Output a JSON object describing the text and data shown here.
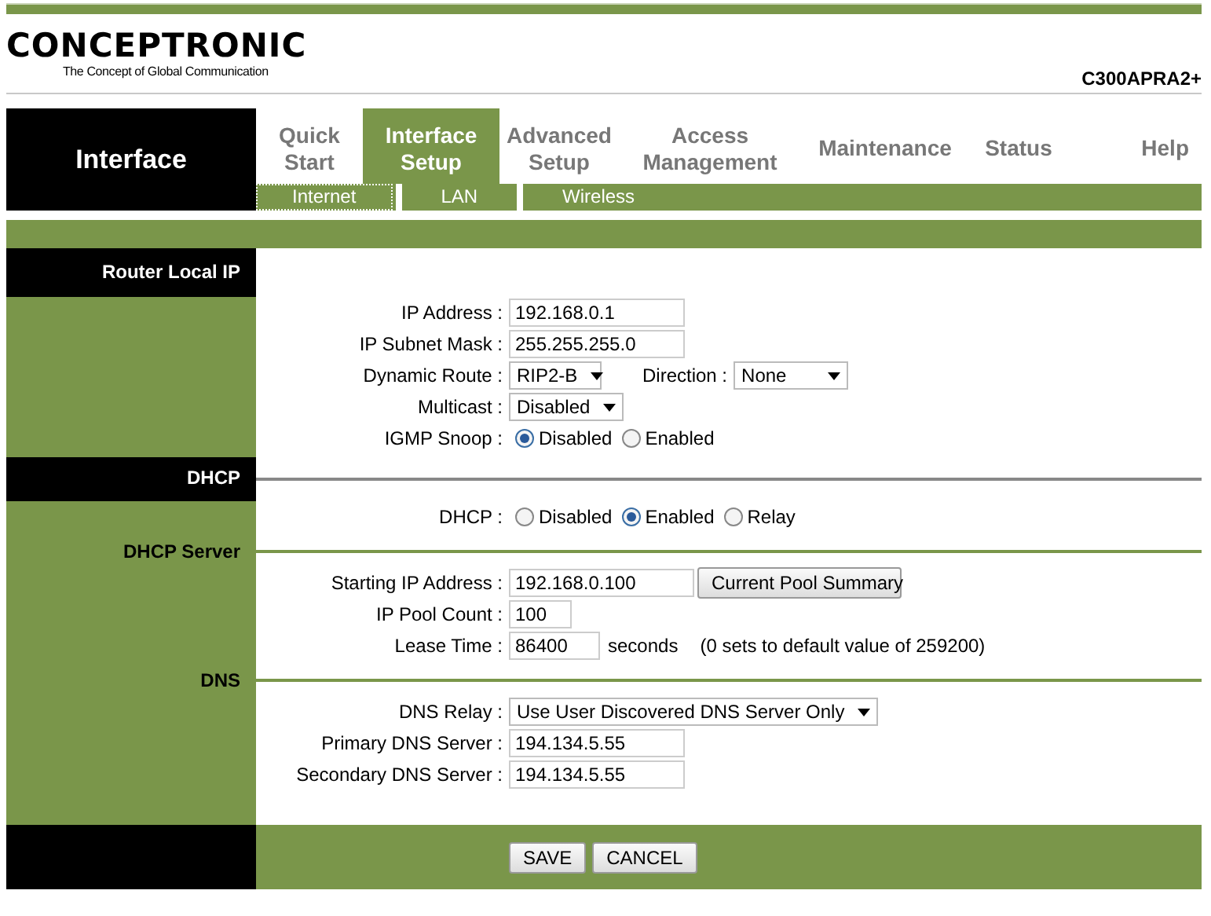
{
  "logo": {
    "brand": "CONCEPTRONIC",
    "tagline": "The Concept of Global Communication"
  },
  "model": "C300APRA2+",
  "section_title": "Interface",
  "tabs": [
    {
      "label": "Quick Start",
      "selected": false
    },
    {
      "label": "Interface Setup",
      "selected": true
    },
    {
      "label": "Advanced Setup",
      "selected": false
    },
    {
      "label": "Access Management",
      "selected": false
    },
    {
      "label": "Maintenance",
      "selected": false
    },
    {
      "label": "Status",
      "selected": false
    },
    {
      "label": "Help",
      "selected": false
    }
  ],
  "subtabs": [
    {
      "label": "Internet",
      "selected": true
    },
    {
      "label": "LAN",
      "selected": false
    },
    {
      "label": "Wireless",
      "selected": false
    }
  ],
  "sections": [
    {
      "title": "Router Local IP",
      "kind": "header",
      "rows": [
        {
          "kind": "input",
          "label": "IP Address :",
          "value": "192.168.0.1"
        },
        {
          "kind": "input",
          "label": "IP Subnet Mask :",
          "value": "255.255.255.0"
        },
        {
          "kind": "select_pair",
          "label": "Dynamic Route :",
          "value": "RIP2-B",
          "extra_label": "Direction :",
          "extra_value": "None"
        },
        {
          "kind": "select",
          "label": "Multicast :",
          "value": "Disabled"
        },
        {
          "kind": "radio",
          "label": "IGMP Snoop :",
          "options": [
            {
              "label": "Disabled",
              "selected": true
            },
            {
              "label": "Enabled",
              "selected": false
            }
          ]
        }
      ]
    },
    {
      "title": "DHCP",
      "kind": "header",
      "rows": [
        {
          "kind": "radio",
          "label": "DHCP :",
          "options": [
            {
              "label": "Disabled",
              "selected": false
            },
            {
              "label": "Enabled",
              "selected": true
            },
            {
              "label": "Relay",
              "selected": false
            }
          ]
        }
      ]
    },
    {
      "title": "DHCP Server",
      "kind": "sub",
      "rows": [
        {
          "kind": "input_button",
          "label": "Starting IP Address :",
          "value": "192.168.0.100",
          "button": "Current Pool Summary"
        },
        {
          "kind": "input_short",
          "label": "IP Pool Count :",
          "value": "100"
        },
        {
          "kind": "input_unit",
          "label": "Lease Time :",
          "value": "86400",
          "unit": "seconds",
          "note": "(0 sets to default value of 259200)"
        }
      ]
    },
    {
      "title": "DNS",
      "kind": "sub",
      "rows": [
        {
          "kind": "select",
          "label": "DNS Relay :",
          "value": "Use User Discovered DNS Server Only"
        },
        {
          "kind": "input",
          "label": "Primary DNS Server :",
          "value": "194.134.5.55"
        },
        {
          "kind": "input",
          "label": "Secondary DNS Server :",
          "value": "194.134.5.55"
        }
      ]
    }
  ],
  "buttons": [
    "SAVE",
    "CANCEL"
  ]
}
